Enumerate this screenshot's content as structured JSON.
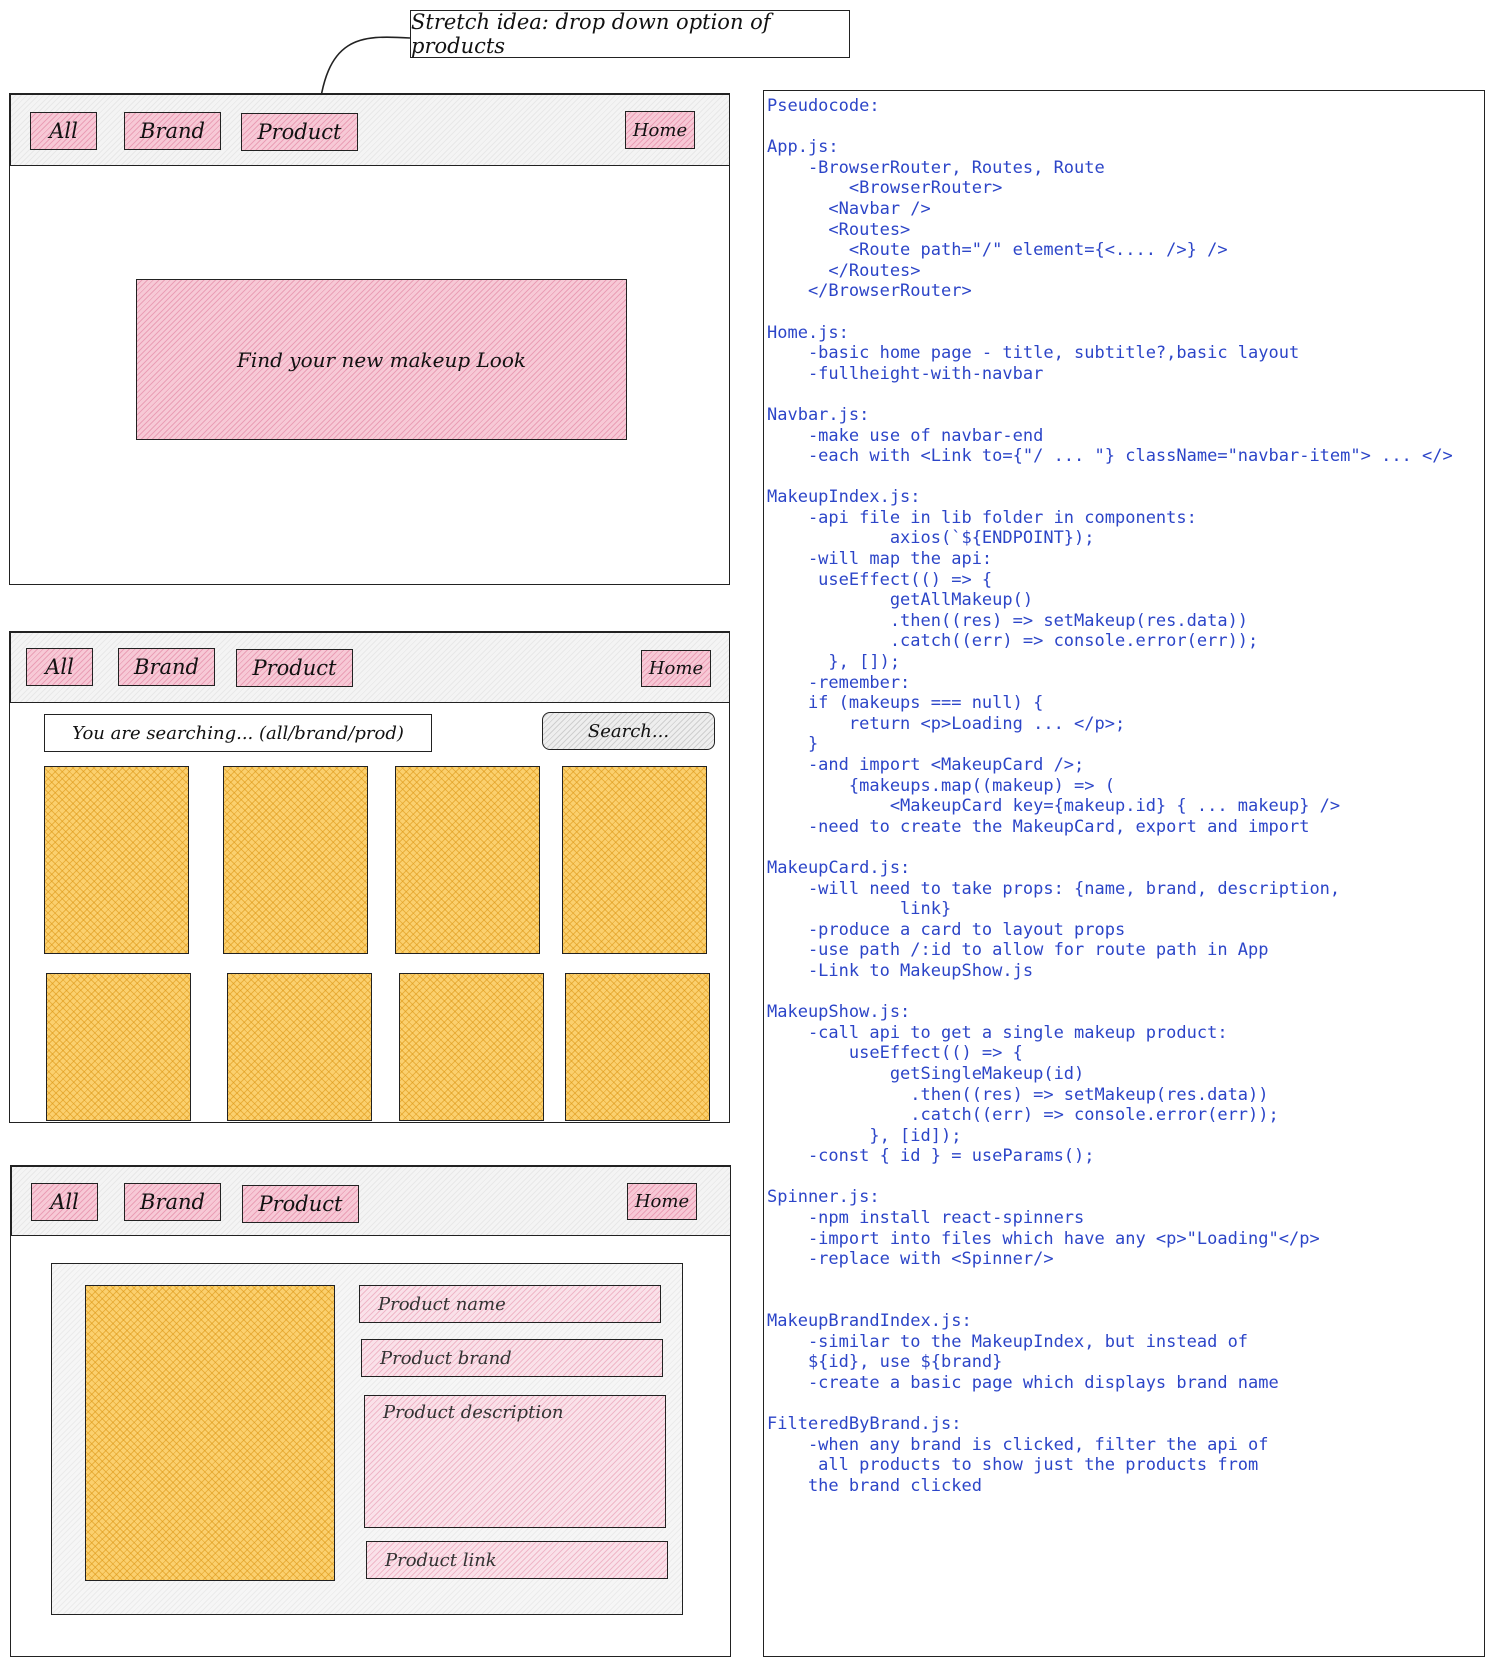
{
  "annotation": "Stretch idea: drop down option of products",
  "wireframe1": {
    "nav": {
      "all": "All",
      "brand": "Brand",
      "product": "Product",
      "home": "Home"
    },
    "hero_text": "Find your new makeup Look"
  },
  "wireframe2": {
    "nav": {
      "all": "All",
      "brand": "Brand",
      "product": "Product",
      "home": "Home"
    },
    "search_label": "You are searching... (all/brand/prod)",
    "search_button": "Search..."
  },
  "wireframe3": {
    "nav": {
      "all": "All",
      "brand": "Brand",
      "product": "Product",
      "home": "Home"
    },
    "fields": {
      "name": "Product name",
      "brand": "Product brand",
      "description": "Product description",
      "link": "Product link"
    }
  },
  "colors": {
    "pink": "#f4bccd",
    "yellow": "#fbd06e",
    "code": "#2c45c8"
  },
  "pseudocode": [
    "Pseudocode:",
    "",
    "App.js:",
    "    -BrowserRouter, Routes, Route",
    "        <BrowserRouter>",
    "      <Navbar />",
    "      <Routes>",
    "        <Route path=\"/\" element={<.... />} />",
    "      </Routes>",
    "    </BrowserRouter>",
    "",
    "Home.js:",
    "    -basic home page - title, subtitle?,basic layout",
    "    -fullheight-with-navbar",
    "",
    "Navbar.js:",
    "    -make use of navbar-end",
    "    -each with <Link to={\"/ ... \"} className=\"navbar-item\"> ... </>",
    "",
    "MakeupIndex.js:",
    "    -api file in lib folder in components:",
    "            axios(`${ENDPOINT});",
    "    -will map the api:",
    "     useEffect(() => {",
    "            getAllMakeup()",
    "            .then((res) => setMakeup(res.data))",
    "            .catch((err) => console.error(err));",
    "      }, []);",
    "    -remember:",
    "    if (makeups === null) {",
    "        return <p>Loading ... </p>;",
    "    }",
    "    -and import <MakeupCard />;",
    "        {makeups.map((makeup) => (",
    "            <MakeupCard key={makeup.id} { ... makeup} />",
    "    -need to create the MakeupCard, export and import",
    "",
    "MakeupCard.js:",
    "    -will need to take props: {name, brand, description,",
    "             link}",
    "    -produce a card to layout props",
    "    -use path /:id to allow for route path in App",
    "    -Link to MakeupShow.js",
    "",
    "MakeupShow.js:",
    "    -call api to get a single makeup product:",
    "        useEffect(() => {",
    "            getSingleMakeup(id)",
    "              .then((res) => setMakeup(res.data))",
    "              .catch((err) => console.error(err));",
    "          }, [id]);",
    "    -const { id } = useParams();",
    "",
    "Spinner.js:",
    "    -npm install react-spinners",
    "    -import into files which have any <p>\"Loading\"</p>",
    "    -replace with <Spinner/>",
    "",
    "",
    "MakeupBrandIndex.js:",
    "    -similar to the MakeupIndex, but instead of",
    "    ${id}, use ${brand}",
    "    -create a basic page which displays brand name",
    "",
    "FilteredByBrand.js:",
    "    -when any brand is clicked, filter the api of",
    "     all products to show just the products from",
    "    the brand clicked"
  ]
}
